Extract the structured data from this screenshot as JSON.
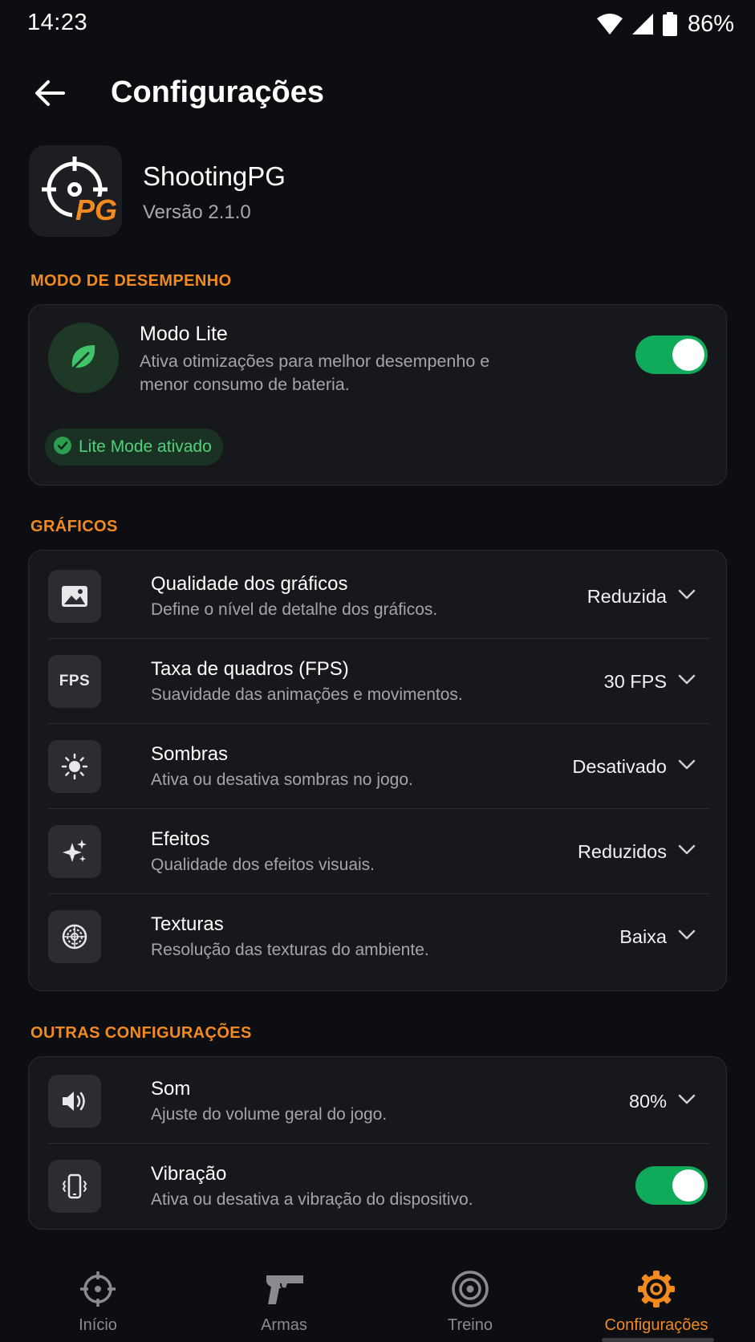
{
  "status_bar": {
    "time": "14:23",
    "battery": "86%"
  },
  "header": {
    "title": "Configurações"
  },
  "app": {
    "name": "ShootingPG",
    "version": "Versão 2.1.0",
    "logo_text": "PG"
  },
  "performance": {
    "section_label": "MODO DE DESEMPENHO",
    "lite_title": "Modo Lite",
    "lite_desc": "Ativa otimizações para melhor desempenho e menor consumo de bateria.",
    "lite_enabled": true,
    "badge": "Lite Mode ativado"
  },
  "graphics": {
    "section_label": "GRÁFICOS",
    "rows": [
      {
        "title": "Qualidade dos gráficos",
        "desc": "Define o nível de detalhe dos gráficos.",
        "value": "Reduzida",
        "icon": "image-icon"
      },
      {
        "title": "Taxa de quadros (FPS)",
        "desc": "Suavidade das animações e movimentos.",
        "value": "30 FPS",
        "icon": "fps-icon",
        "icon_text": "FPS"
      },
      {
        "title": "Sombras",
        "desc": "Ativa ou desativa sombras no jogo.",
        "value": "Desativado",
        "icon": "sun-icon"
      },
      {
        "title": "Efeitos",
        "desc": "Qualidade dos efeitos visuais.",
        "value": "Reduzidos",
        "icon": "sparkle-icon"
      },
      {
        "title": "Texturas",
        "desc": "Resolução das texturas do ambiente.",
        "value": "Baixa",
        "icon": "texture-icon"
      }
    ]
  },
  "other": {
    "section_label": "OUTRAS CONFIGURAÇÕES",
    "sound": {
      "title": "Som",
      "desc": "Ajuste do volume geral do jogo.",
      "value": "80%"
    },
    "vibration": {
      "title": "Vibração",
      "desc": "Ativa ou desativa a vibração do dispositivo.",
      "enabled": true
    }
  },
  "nav": {
    "items": [
      {
        "label": "Início",
        "icon": "crosshair-icon"
      },
      {
        "label": "Armas",
        "icon": "pistol-icon"
      },
      {
        "label": "Treino",
        "icon": "target-icon"
      },
      {
        "label": "Configurações",
        "icon": "gear-icon",
        "active": true
      }
    ]
  },
  "colors": {
    "accent": "#f28a1f",
    "toggle_on": "#0faa5a",
    "success": "#52d07a",
    "background": "#0d0e11",
    "card": "#17181c"
  }
}
